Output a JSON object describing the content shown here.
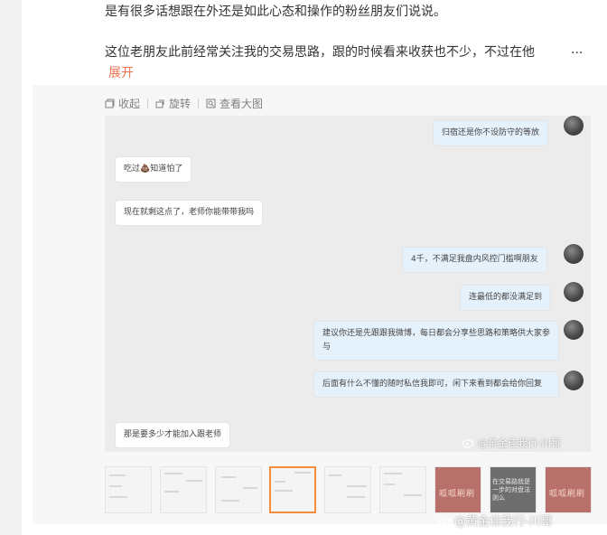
{
  "post": {
    "line1": "是有很多话想跟在外还是如此心态和操作的粉丝朋友们说说。",
    "line2": "这位老朋友此前经常关注我的交易思路，跟的时候看来收获也不少，不过在他",
    "ellipsis": "...",
    "expand_label": "展开"
  },
  "toolbar": {
    "collapse_label": "收起",
    "rotate_label": "旋转",
    "view_large_label": "查看大图"
  },
  "chat": {
    "messages": [
      {
        "side": "right",
        "text": "归宿还是你不设防守的等放"
      },
      {
        "side": "left",
        "text": "吃过💩知道怕了"
      },
      {
        "side": "left",
        "text": "现在就剩这点了，老师你能带带我吗"
      },
      {
        "side": "right",
        "text": "4千，不满足我盘内风控门槛啊朋友"
      },
      {
        "side": "right",
        "text": "连最低的都没满足到"
      },
      {
        "side": "right",
        "text": "建议你还是先跟跟我微博，每日都会分享些思路和策略供大家参与"
      },
      {
        "side": "right",
        "text": "后面有什么不懂的随时私信我即可，闲下来看到都会给你回复"
      },
      {
        "side": "left",
        "text": "那是要多少才能加入跟老师"
      }
    ]
  },
  "watermark": {
    "inner": "@黄金佳我行-川哥",
    "outer": "@黄金佳我行-川哥"
  },
  "thumbnails": {
    "red_caption": "呱呱刷刷",
    "dark_caption": "在交易路就是一步的对盘法则么"
  },
  "colors": {
    "accent": "#eb7350",
    "active_thumb": "#f58b3c",
    "bubble_right": "#e6f2fb"
  }
}
